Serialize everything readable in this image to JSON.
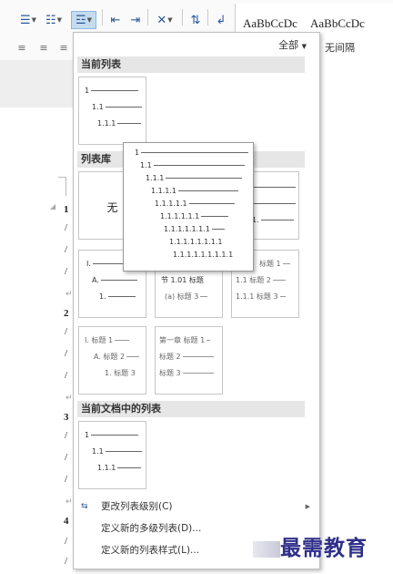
{
  "styles": {
    "style1_sample": "AaBbCcDc",
    "style2_sample": "AaBbCcDc",
    "style2_name": "无间隔"
  },
  "document": {
    "nums": [
      "1",
      "2",
      "3",
      "4"
    ],
    "bar": "/"
  },
  "panel": {
    "filter_label": "全部",
    "sections": {
      "current": "当前列表",
      "library": "列表库",
      "document": "当前文档中的列表"
    },
    "none_label": "无",
    "current_list": [
      "1",
      "1.1",
      "1.1.1"
    ],
    "popup_levels": [
      "1",
      "1.1",
      "1.1.1",
      "1.1.1.1",
      "1.1.1.1.1",
      "1.1.1.1.1.1",
      "1.1.1.1.1.1.1",
      "1.1.1.1.1.1.1.1",
      "1.1.1.1.1.1.1.1.1"
    ],
    "lib_topright": [
      "",
      "",
      "1."
    ],
    "lib_row2": [
      {
        "lines": [
          "I.",
          "A.",
          "1."
        ]
      },
      {
        "lines": [
          "节 1.01 标题",
          "(a) 标题 3"
        ]
      },
      {
        "lines": [
          "标题 1",
          "1.1 标题 2",
          "1.1.1 标题 3"
        ]
      }
    ],
    "lib_row3": [
      {
        "lines": [
          "I. 标题 1",
          "A. 标题 2",
          "1. 标题 3"
        ]
      },
      {
        "lines": [
          "第一章 标题 1",
          "标题 2",
          "标题 3"
        ]
      }
    ],
    "doc_list": [
      "1",
      "1.1",
      "1.1.1"
    ],
    "commands": [
      {
        "label": "更改列表级别(C)",
        "submenu": true
      },
      {
        "label": "定义新的多级列表(D)...",
        "submenu": false
      },
      {
        "label": "定义新的列表样式(L)...",
        "submenu": false
      }
    ]
  },
  "watermark": {
    "text": "最需教育"
  }
}
